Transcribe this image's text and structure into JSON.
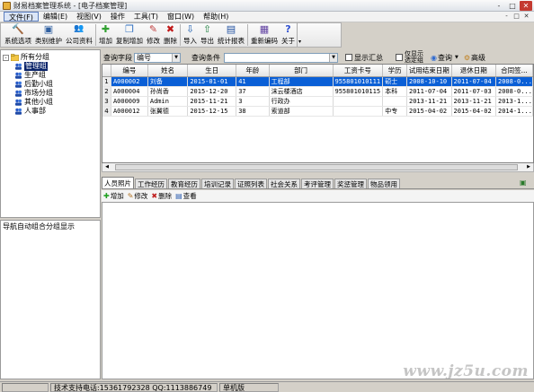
{
  "window": {
    "title": "财易档案管理系统 - [电子档案管理]",
    "buttons": [
      "-",
      "□",
      "✕"
    ]
  },
  "menu": [
    "文件(F)",
    "编辑(E)",
    "视图(V)",
    "操作",
    "工具(T)",
    "窗口(W)",
    "帮助(H)"
  ],
  "toolbar": [
    {
      "label": "系统选项",
      "icon": "hammer-icon",
      "glyph": "🔨",
      "color": "#b07020"
    },
    {
      "label": "类别维护",
      "icon": "tree-icon",
      "glyph": "▣",
      "color": "#3060a0"
    },
    {
      "label": "公司资料",
      "icon": "people-icon",
      "glyph": "👥",
      "color": "#c07030"
    },
    {
      "label": "增加",
      "icon": "add-user-icon",
      "glyph": "✚",
      "color": "#30a030"
    },
    {
      "label": "复制增加",
      "icon": "copy-add-icon",
      "glyph": "❐",
      "color": "#3070c0"
    },
    {
      "label": "修改",
      "icon": "edit-icon",
      "glyph": "✎",
      "color": "#c04040"
    },
    {
      "label": "删除",
      "icon": "delete-icon",
      "glyph": "✖",
      "color": "#c01818"
    },
    {
      "label": "导入",
      "icon": "import-icon",
      "glyph": "⇩",
      "color": "#2060b0"
    },
    {
      "label": "导出",
      "icon": "export-icon",
      "glyph": "⇧",
      "color": "#208040"
    },
    {
      "label": "统计报表",
      "icon": "report-icon",
      "glyph": "▤",
      "color": "#2050a0"
    },
    {
      "label": "重新编码",
      "icon": "recode-icon",
      "glyph": "▦",
      "color": "#6040a0"
    },
    {
      "label": "关于",
      "icon": "help-icon",
      "glyph": "?",
      "color": "#3050d0"
    }
  ],
  "tree": [
    {
      "label": "所有分组",
      "level": 0,
      "expander": "-"
    },
    {
      "label": "管理组",
      "level": 1,
      "selected": true
    },
    {
      "label": "生产组",
      "level": 1
    },
    {
      "label": "后勤小组",
      "level": 1
    },
    {
      "label": "市场分组",
      "level": 1
    },
    {
      "label": "其他小组",
      "level": 1
    },
    {
      "label": "人事部",
      "level": 1
    }
  ],
  "nav_label": "导航自动组合分组显示",
  "filter": {
    "field_label": "查询字段",
    "field_value": "编号",
    "cond_label": "查询条件",
    "cond_value": "",
    "check1": "显示汇总",
    "check2_line1": "仅显示",
    "check2_line2": "选定组",
    "query_btn": "查询",
    "advanced_btn": "高级"
  },
  "grid": {
    "columns": [
      "编号",
      "姓名",
      "生日",
      "年龄",
      "部门",
      "工资卡号",
      "学历",
      "试用结束日期",
      "退休日期",
      "合同签..."
    ],
    "rows": [
      {
        "n": "1",
        "cells": [
          "A000002",
          "刘备",
          "2015-01-01",
          "41",
          "工程部",
          "955801010111",
          "硕士",
          "2008-10-10",
          "2011-07-04",
          "2008-0..."
        ],
        "selected": true
      },
      {
        "n": "2",
        "cells": [
          "A000004",
          "孙尚香",
          "2015-12-20",
          "37",
          "沫云楼酒店",
          "955801010115",
          "本科",
          "2011-07-04",
          "2011-07-03",
          "2008-0..."
        ]
      },
      {
        "n": "3",
        "cells": [
          "A000009",
          "Admin",
          "2015-11-21",
          "3",
          "行政办",
          "",
          "",
          "2013-11-21",
          "2013-11-21",
          "2013-1..."
        ]
      },
      {
        "n": "4",
        "cells": [
          "A000012",
          "张翼德",
          "2015-12-15",
          "38",
          "索道部",
          "",
          "中专",
          "2015-04-02",
          "2015-04-02",
          "2014-1..."
        ]
      }
    ]
  },
  "tabs": [
    "人员照片",
    "工作经历",
    "教育经历",
    "培训记录",
    "证照列表",
    "社会关系",
    "考评管理",
    "奖惩管理",
    "物品领用"
  ],
  "subtoolbar": [
    {
      "label": "增加",
      "icon": "add-icon",
      "glyph": "✚",
      "color": "#20a020"
    },
    {
      "label": "修改",
      "icon": "edit-icon",
      "glyph": "✎",
      "color": "#b07020"
    },
    {
      "label": "删除",
      "icon": "delete-icon",
      "glyph": "✖",
      "color": "#c02020"
    },
    {
      "label": "查看",
      "icon": "view-icon",
      "glyph": "▤",
      "color": "#3060b0"
    }
  ],
  "status": {
    "support": "技术支持电话:15361792328 QQ:1113886749",
    "edition": "单机版"
  },
  "watermark": "www.jz5u.com"
}
